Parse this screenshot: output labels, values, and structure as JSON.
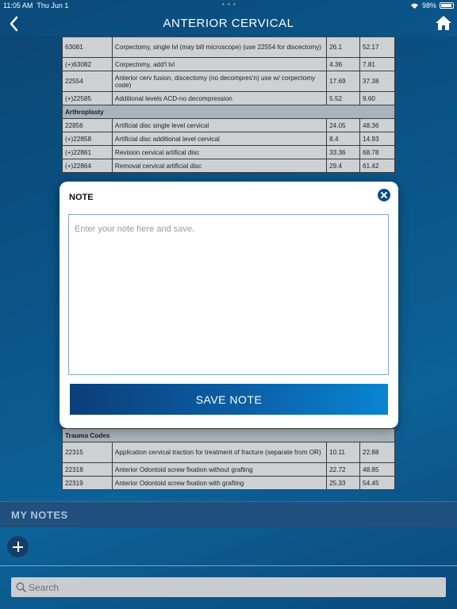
{
  "status": {
    "time": "11:05 AM",
    "date": "Thu Jun 1",
    "dots": "• • •",
    "battery": "98%"
  },
  "nav": {
    "title": "ANTERIOR CERVICAL"
  },
  "table_top": {
    "rows": [
      {
        "code": "63081",
        "desc": "Corpectomy, single lvl (may bill microscope) (use 22554 for discectomy)",
        "v1": "26.1",
        "v2": "52.17"
      },
      {
        "code": "(+)63082",
        "desc": "Corpectomy, add'l lvl",
        "v1": "4.36",
        "v2": "7.81"
      },
      {
        "code": "22554",
        "desc": "Anterior cerv fusion, discectomy (no decompres'n) use w/ corpectomy code)",
        "v1": "17.69",
        "v2": "37.38"
      },
      {
        "code": "(+)22585",
        "desc": "Additional levels ACD-no decompression",
        "v1": "5.52",
        "v2": "9.60"
      }
    ],
    "section": "Arthroplasty",
    "rows2": [
      {
        "code": "22856",
        "desc": "Artificial disc single level cervical",
        "v1": "24.05",
        "v2": "48.36"
      },
      {
        "code": "(+)22858",
        "desc": "Artificial disc additional level cervical",
        "v1": "8.4",
        "v2": "14.93"
      },
      {
        "code": "(+)22861",
        "desc": "Revision cervical artifical disc",
        "v1": "33.36",
        "v2": "68.78"
      },
      {
        "code": "(+)22864",
        "desc": "Removal cervical artificial disc",
        "v1": "29.4",
        "v2": "61.42"
      }
    ]
  },
  "table_bottom": {
    "section": "Trauma Codes",
    "rows": [
      {
        "code": "22315",
        "desc": "Application cervical traction for treatment of fracture (separate from OR)",
        "v1": "10.11",
        "v2": "22.88"
      },
      {
        "code": "22318",
        "desc": "Anterior Odontoid screw fixation without grafting",
        "v1": "22.72",
        "v2": "48.85"
      },
      {
        "code": "22319",
        "desc": "Anterior Odontoid screw fixation with grafting",
        "v1": "25.33",
        "v2": "54.45"
      }
    ]
  },
  "modal": {
    "title": "NOTE",
    "placeholder": "Enter your note here and save.",
    "save_label": "SAVE NOTE"
  },
  "my_notes": {
    "title": "MY NOTES"
  },
  "search": {
    "placeholder": "Search"
  },
  "colors": {
    "accent": "#0e4c8c",
    "background": "#0a5b93"
  }
}
